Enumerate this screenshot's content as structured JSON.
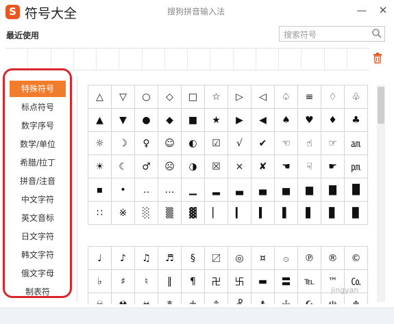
{
  "window": {
    "logo_letter": "S",
    "title": "符号大全",
    "subtitle": "搜狗拼音输入法",
    "minimize_glyph": "—",
    "close_glyph": "✕"
  },
  "recent": {
    "title": "最近使用"
  },
  "search": {
    "placeholder": "搜索符号",
    "value": ""
  },
  "sidebar": {
    "items": [
      {
        "label": "特殊符号",
        "active": true
      },
      {
        "label": "标点符号"
      },
      {
        "label": "数字序号"
      },
      {
        "label": "数学/单位"
      },
      {
        "label": "希腊/拉丁"
      },
      {
        "label": "拼音/注音"
      },
      {
        "label": "中文字符"
      },
      {
        "label": "英文音标"
      },
      {
        "label": "日文字符"
      },
      {
        "label": "韩文字符"
      },
      {
        "label": "俄文字母"
      },
      {
        "label": "制表符"
      }
    ]
  },
  "symbols_group1": [
    [
      "△",
      "▽",
      "○",
      "◇",
      "□",
      "☆",
      "▷",
      "◁",
      "♤",
      "≡",
      "♢",
      "♧"
    ],
    [
      "▲",
      "▼",
      "●",
      "◆",
      "■",
      "★",
      "▶",
      "◀",
      "♠",
      "♥",
      "♦",
      "♣"
    ],
    [
      "☼",
      "☽",
      "♀",
      "☺",
      "◐",
      "☑",
      "√",
      "✔",
      "☜",
      "☝",
      "☞",
      "㏂"
    ],
    [
      "☀",
      "☾",
      "♂",
      "☹",
      "◑",
      "☒",
      "×",
      "✘",
      "☚",
      "☟",
      "☛",
      "㏘"
    ],
    [
      "▪",
      "•",
      "‥",
      "…",
      "▁",
      "▂",
      "▃",
      "▄",
      "▅",
      "▆",
      "▇",
      "█"
    ],
    [
      "∷",
      "※",
      "░",
      "▒",
      "▓",
      "▏",
      "▎",
      "▍",
      "▌",
      "▋",
      "▊",
      "▉"
    ]
  ],
  "symbols_group2": [
    [
      "♩",
      "♪",
      "♫",
      "♬",
      "§",
      "〼",
      "◎",
      "¤",
      "۞",
      "℗",
      "®",
      "©"
    ],
    [
      "♭",
      "♯",
      "♮",
      "‖",
      "¶",
      "卍",
      "卐",
      "▬",
      "〓",
      "℡",
      "™",
      "㏇"
    ],
    [
      "☠",
      "☢",
      "☣",
      "☤",
      "☥",
      "☦",
      "☧",
      "☨",
      "☩",
      "☪",
      "☫",
      "☬"
    ]
  ],
  "watermark": "jingyan",
  "colors": {
    "accent_orange": "#f07c2c",
    "highlight_red": "#d8262b",
    "logo": "#e8571f"
  }
}
